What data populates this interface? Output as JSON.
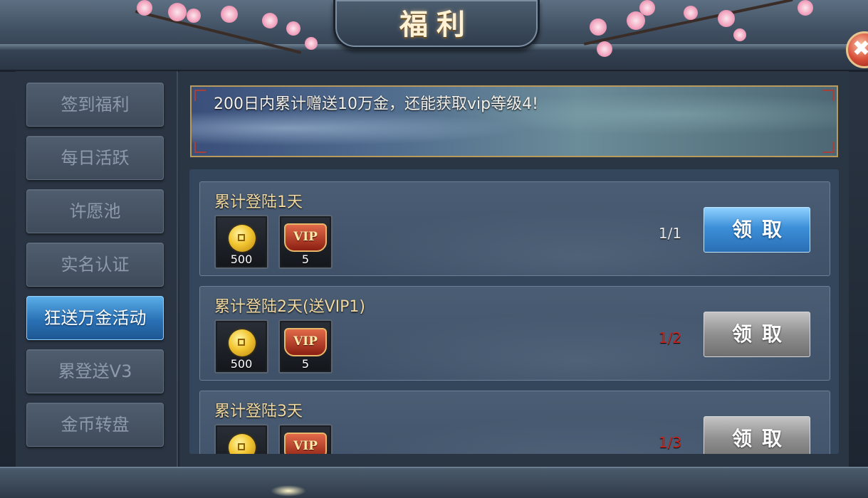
{
  "window": {
    "title": "福利",
    "close_icon": "✖"
  },
  "sidebar": {
    "items": [
      {
        "label": "签到福利",
        "active": false
      },
      {
        "label": "每日活跃",
        "active": false
      },
      {
        "label": "许愿池",
        "active": false
      },
      {
        "label": "实名认证",
        "active": false
      },
      {
        "label": "狂送万金活动",
        "active": true
      },
      {
        "label": "累登送V3",
        "active": false
      },
      {
        "label": "金币转盘",
        "active": false
      }
    ]
  },
  "banner": {
    "text": "200日内累计赠送10万金，还能获取vip等级4!"
  },
  "rewards": [
    {
      "title": "累计登陆1天",
      "items": [
        {
          "icon": "gold-coin-icon",
          "count": "500"
        },
        {
          "icon": "vip-emblem-icon",
          "label": "VIP",
          "count": "5"
        }
      ],
      "progress": "1/1",
      "progress_color": "#e8e8e8",
      "button": "领取",
      "claimable": true
    },
    {
      "title": "累计登陆2天(送VIP1)",
      "items": [
        {
          "icon": "gold-coin-icon",
          "count": "500"
        },
        {
          "icon": "vip-emblem-icon",
          "label": "VIP",
          "count": "5"
        }
      ],
      "progress": "1/2",
      "progress_color": "#c8231c",
      "button": "领取",
      "claimable": false
    },
    {
      "title": "累计登陆3天",
      "items": [
        {
          "icon": "gold-coin-icon",
          "count": ""
        },
        {
          "icon": "vip-emblem-icon",
          "label": "VIP",
          "count": ""
        }
      ],
      "progress": "1/3",
      "progress_color": "#c8231c",
      "button": "领取",
      "claimable": false
    }
  ]
}
